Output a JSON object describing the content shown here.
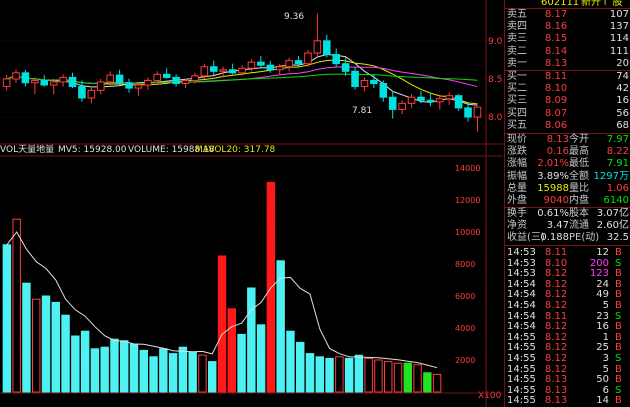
{
  "header": {
    "stock_code": "602111",
    "stock_name": "新开↑ 股"
  },
  "price_chart": {
    "y_ticks": [
      "9.00",
      "8.50",
      "8.00"
    ],
    "y_tick_values": [
      9.0,
      8.5,
      8.0
    ],
    "ylim": [
      7.83,
      9.47
    ],
    "high_label": "9.36",
    "high_value": 9.36,
    "low_label": "7.81",
    "low_value": 7.81
  },
  "volume_chart": {
    "indicator_name": "VOL天量地量",
    "indicators": [
      {
        "label": "MV5: 15928.00",
        "color": "#e0e0e0"
      },
      {
        "label": "VOLUME: 15988.18",
        "color": "#e0e0e0"
      },
      {
        "label": "MAVOL20: 317.78",
        "color": "#e8e800"
      }
    ],
    "y_ticks": [
      "14000",
      "12000",
      "10000",
      "8000",
      "6000",
      "4000",
      "2000"
    ],
    "y_tick_values": [
      14000,
      12000,
      10000,
      8000,
      6000,
      4000,
      2000
    ],
    "ylim": [
      0,
      14500
    ],
    "unit_label": "X100"
  },
  "chart_data": [
    {
      "type": "candlestick",
      "series": [
        {
          "name": "price",
          "ohlc": [
            [
              8.4,
              8.55,
              8.35,
              8.5
            ],
            [
              8.5,
              8.62,
              8.45,
              8.58
            ],
            [
              8.58,
              8.62,
              8.4,
              8.45
            ],
            [
              8.45,
              8.52,
              8.3,
              8.48
            ],
            [
              8.48,
              8.55,
              8.4,
              8.42
            ],
            [
              8.42,
              8.5,
              8.3,
              8.46
            ],
            [
              8.46,
              8.56,
              8.4,
              8.52
            ],
            [
              8.52,
              8.58,
              8.38,
              8.4
            ],
            [
              8.4,
              8.48,
              8.2,
              8.25
            ],
            [
              8.25,
              8.4,
              8.18,
              8.35
            ],
            [
              8.35,
              8.5,
              8.3,
              8.46
            ],
            [
              8.46,
              8.6,
              8.4,
              8.55
            ],
            [
              8.55,
              8.62,
              8.42,
              8.45
            ],
            [
              8.45,
              8.5,
              8.32,
              8.38
            ],
            [
              8.38,
              8.46,
              8.28,
              8.42
            ],
            [
              8.42,
              8.52,
              8.36,
              8.48
            ],
            [
              8.48,
              8.6,
              8.44,
              8.56
            ],
            [
              8.56,
              8.64,
              8.5,
              8.52
            ],
            [
              8.52,
              8.56,
              8.4,
              8.44
            ],
            [
              8.44,
              8.5,
              8.38,
              8.48
            ],
            [
              8.48,
              8.58,
              8.44,
              8.54
            ],
            [
              8.54,
              8.7,
              8.5,
              8.66
            ],
            [
              8.66,
              8.74,
              8.55,
              8.6
            ],
            [
              8.6,
              8.66,
              8.52,
              8.62
            ],
            [
              8.62,
              8.7,
              8.56,
              8.58
            ],
            [
              8.58,
              8.68,
              8.54,
              8.64
            ],
            [
              8.64,
              8.76,
              8.6,
              8.72
            ],
            [
              8.72,
              8.8,
              8.64,
              8.68
            ],
            [
              8.68,
              8.74,
              8.58,
              8.62
            ],
            [
              8.62,
              8.7,
              8.56,
              8.66
            ],
            [
              8.66,
              8.78,
              8.6,
              8.74
            ],
            [
              8.74,
              8.8,
              8.66,
              8.7
            ],
            [
              8.7,
              8.88,
              8.66,
              8.84
            ],
            [
              8.84,
              9.36,
              8.8,
              9.0
            ],
            [
              9.0,
              9.08,
              8.78,
              8.82
            ],
            [
              8.82,
              8.9,
              8.66,
              8.7
            ],
            [
              8.7,
              8.78,
              8.54,
              8.6
            ],
            [
              8.6,
              8.66,
              8.36,
              8.4
            ],
            [
              8.4,
              8.52,
              8.34,
              8.48
            ],
            [
              8.48,
              8.56,
              8.38,
              8.44
            ],
            [
              8.44,
              8.48,
              8.2,
              8.26
            ],
            [
              8.26,
              8.34,
              7.98,
              8.1
            ],
            [
              8.1,
              8.22,
              8.04,
              8.18
            ],
            [
              8.18,
              8.3,
              8.12,
              8.26
            ],
            [
              8.26,
              8.34,
              8.18,
              8.22
            ],
            [
              8.22,
              8.3,
              8.14,
              8.2
            ],
            [
              8.2,
              8.28,
              8.1,
              8.24
            ],
            [
              8.24,
              8.32,
              8.16,
              8.28
            ],
            [
              8.28,
              8.3,
              8.08,
              8.12
            ],
            [
              8.12,
              8.18,
              7.94,
              8.0
            ],
            [
              8.0,
              8.14,
              7.81,
              8.13
            ]
          ]
        }
      ]
    },
    {
      "type": "bar",
      "series": [
        {
          "name": "volume",
          "values": [
            9200,
            10800,
            6800,
            5800,
            6000,
            5600,
            4800,
            3500,
            3800,
            2700,
            2800,
            3300,
            3200,
            3000,
            2600,
            2200,
            2700,
            2400,
            2800,
            2500,
            2300,
            1900,
            8500,
            5200,
            3600,
            6500,
            4200,
            13100,
            8200,
            3800,
            3100,
            2400,
            2200,
            2100,
            2200,
            2100,
            2300,
            2100,
            2000,
            1900,
            1800,
            1800,
            1700,
            1200,
            1100
          ],
          "colors": [
            "c",
            "o",
            "c",
            "o",
            "c",
            "c",
            "c",
            "c",
            "c",
            "c",
            "c",
            "c",
            "c",
            "c",
            "c",
            "c",
            "c",
            "c",
            "c",
            "c",
            "o",
            "c",
            "r",
            "r",
            "c",
            "c",
            "c",
            "r",
            "c",
            "c",
            "c",
            "c",
            "c",
            "c",
            "o",
            "c",
            "c",
            "o",
            "o",
            "o",
            "o",
            "g",
            "o",
            "g",
            "o"
          ]
        }
      ]
    }
  ],
  "quote_panel": {
    "asks": [
      {
        "label": "卖五",
        "price": "8.17",
        "vol": "107"
      },
      {
        "label": "卖四",
        "price": "8.16",
        "vol": "137"
      },
      {
        "label": "卖三",
        "price": "8.15",
        "vol": "114"
      },
      {
        "label": "卖二",
        "price": "8.14",
        "vol": "111"
      },
      {
        "label": "卖一",
        "price": "8.13",
        "vol": "20"
      }
    ],
    "bids": [
      {
        "label": "买一",
        "price": "8.11",
        "vol": "74"
      },
      {
        "label": "买二",
        "price": "8.10",
        "vol": "42"
      },
      {
        "label": "买三",
        "price": "8.09",
        "vol": "16"
      },
      {
        "label": "买四",
        "price": "8.07",
        "vol": "56"
      },
      {
        "label": "买五",
        "price": "8.06",
        "vol": "68"
      }
    ],
    "stats": [
      {
        "l1": "现价",
        "v1": "8.13",
        "c1": "red",
        "l2": "今开",
        "v2": "7.97",
        "c2": "grn"
      },
      {
        "l1": "涨跌",
        "v1": "0.16",
        "c1": "red",
        "l2": "最高",
        "v2": "8.22",
        "c2": "red"
      },
      {
        "l1": "涨幅",
        "v1": "2.01%",
        "c1": "red",
        "l2": "最低",
        "v2": "7.91",
        "c2": "grn"
      },
      {
        "l1": "振幅",
        "v1": "3.89%",
        "c1": "wht",
        "l2": "全额",
        "v2": "1297万",
        "c2": "cyn"
      },
      {
        "l1": "总量",
        "v1": "15988",
        "c1": "yel",
        "l2": "量比",
        "v2": "1.06",
        "c2": "red"
      },
      {
        "l1": "外盘",
        "v1": "9040",
        "c1": "red",
        "l2": "内盘",
        "v2": "6140",
        "c2": "grn"
      }
    ],
    "fundamentals": [
      {
        "l1": "换手",
        "v1": "0.61%",
        "l2": "股本",
        "v2": "3.07亿"
      },
      {
        "l1": "净资",
        "v1": "3.47",
        "l2": "流通",
        "v2": "2.60亿"
      },
      {
        "l1": "收益(三)",
        "v1": "0.188",
        "l2": "PE(动)",
        "v2": "32.5"
      }
    ],
    "ticks": [
      {
        "time": "14:53",
        "price": "8.11",
        "vol": "12",
        "side": "B",
        "vc": "wht"
      },
      {
        "time": "14:53",
        "price": "8.10",
        "vol": "200",
        "side": "S",
        "vc": "mag"
      },
      {
        "time": "14:53",
        "price": "8.12",
        "vol": "123",
        "side": "B",
        "vc": "mag"
      },
      {
        "time": "14:54",
        "price": "8.12",
        "vol": "24",
        "side": "B",
        "vc": "wht"
      },
      {
        "time": "14:54",
        "price": "8.12",
        "vol": "49",
        "side": "B",
        "vc": "wht"
      },
      {
        "time": "14:54",
        "price": "8.12",
        "vol": "5",
        "side": "B",
        "vc": "wht"
      },
      {
        "time": "14:54",
        "price": "8.11",
        "vol": "23",
        "side": "S",
        "vc": "wht"
      },
      {
        "time": "14:54",
        "price": "8.12",
        "vol": "16",
        "side": "B",
        "vc": "wht"
      },
      {
        "time": "14:55",
        "price": "8.12",
        "vol": "1",
        "side": "B",
        "vc": "wht"
      },
      {
        "time": "14:55",
        "price": "8.12",
        "vol": "25",
        "side": "B",
        "vc": "wht"
      },
      {
        "time": "14:55",
        "price": "8.12",
        "vol": "3",
        "side": "S",
        "vc": "wht"
      },
      {
        "time": "14:55",
        "price": "8.12",
        "vol": "5",
        "side": "B",
        "vc": "wht"
      },
      {
        "time": "14:55",
        "price": "8.13",
        "vol": "50",
        "side": "B",
        "vc": "wht"
      },
      {
        "time": "14:55",
        "price": "8.13",
        "vol": "6",
        "side": "S",
        "vc": "wht"
      },
      {
        "time": "14:55",
        "price": "8.13",
        "vol": "14",
        "side": "B",
        "vc": "wht"
      }
    ]
  },
  "colors": {
    "up": "#ff3c3c",
    "down": "#00e0e0",
    "bg": "#000000",
    "grid": "#7a1010"
  }
}
